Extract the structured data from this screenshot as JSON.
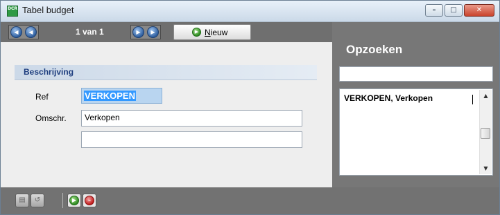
{
  "window": {
    "title": "Tabel budget",
    "icon": "app-table-icon",
    "controls": {
      "minimize": "–",
      "maximize": "□",
      "close": "✕"
    }
  },
  "toolbar": {
    "nav_first_icon": "first-record-icon",
    "nav_prev_icon": "previous-record-icon",
    "record_position": "1 van 1",
    "nav_next_icon": "next-record-icon",
    "nav_last_icon": "last-record-icon",
    "new_button": {
      "prefix": "",
      "underlined": "N",
      "rest": "ieuw",
      "icon": "add-icon"
    }
  },
  "form": {
    "section_title": "Beschrijving",
    "fields": {
      "ref": {
        "label": "Ref",
        "value": "VERKOPEN"
      },
      "omschr": {
        "label": "Omschr.",
        "value": "Verkopen"
      },
      "omschr2": {
        "value": ""
      }
    }
  },
  "lookup": {
    "title": "Opzoeken",
    "search_value": "",
    "items": [
      "VERKOPEN, Verkopen"
    ]
  },
  "bottom_toolbar": {
    "buttons": [
      "save-icon",
      "revert-icon",
      "ok-icon",
      "cancel-icon"
    ]
  },
  "colors": {
    "toolbar_bg": "#6f6f6f",
    "section_header_text": "#1f3f7f",
    "selection_bg": "#3399ff"
  }
}
